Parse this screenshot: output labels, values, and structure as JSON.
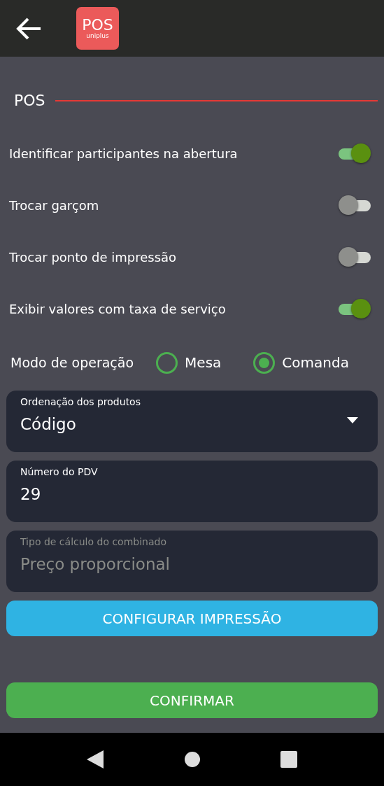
{
  "app_bar": {
    "logo_title": "POS",
    "logo_subtitle": "uniplus"
  },
  "section": {
    "title": "POS"
  },
  "toggles": [
    {
      "label": "Identificar participantes na abertura",
      "on": true
    },
    {
      "label": "Trocar garçom",
      "on": false
    },
    {
      "label": "Trocar ponto de impressão",
      "on": false
    },
    {
      "label": "Exibir valores com taxa de serviço",
      "on": true
    }
  ],
  "operation_mode": {
    "label": "Modo de operação",
    "options": [
      {
        "label": "Mesa",
        "selected": false
      },
      {
        "label": "Comanda",
        "selected": true
      }
    ]
  },
  "fields": [
    {
      "kind": "select",
      "label": "Ordenação dos produtos",
      "value": "Código",
      "disabled": false
    },
    {
      "kind": "input",
      "label": "Número do PDV",
      "value": "29",
      "disabled": false
    },
    {
      "kind": "input",
      "label": "Tipo de cálculo do combinado",
      "value": "Preço proporcional",
      "disabled": true
    }
  ],
  "buttons": [
    {
      "kind": "secondary",
      "label": "CONFIGURAR IMPRESSÃO"
    },
    {
      "kind": "primary",
      "label": "CONFIRMAR"
    }
  ]
}
